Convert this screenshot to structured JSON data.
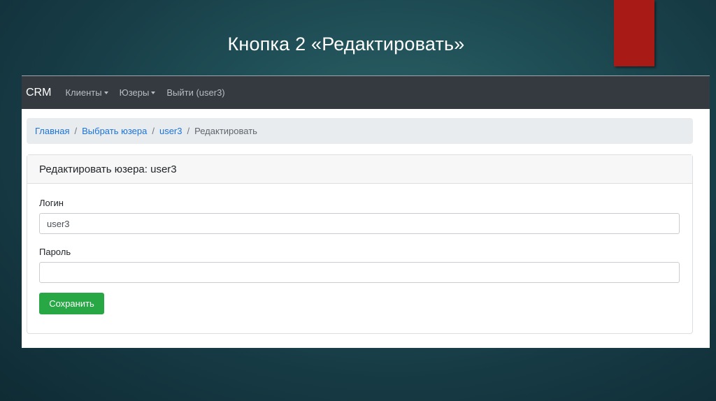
{
  "slide": {
    "title": "Кнопка 2 «Редактировать»"
  },
  "navbar": {
    "brand": "CRM",
    "items": [
      {
        "label": "Клиенты",
        "has_dropdown": true
      },
      {
        "label": "Юзеры",
        "has_dropdown": true
      },
      {
        "label": "Выйти (user3)",
        "has_dropdown": false
      }
    ]
  },
  "breadcrumb": {
    "items": [
      {
        "label": "Главная",
        "link": true
      },
      {
        "label": "Выбрать юзера",
        "link": true
      },
      {
        "label": "user3",
        "link": true
      },
      {
        "label": "Редактировать",
        "link": false
      }
    ],
    "separator": "/"
  },
  "card": {
    "header": "Редактировать юзера: user3",
    "login_label": "Логин",
    "login_value": "user3",
    "password_label": "Пароль",
    "password_value": "",
    "save_label": "Сохранить"
  },
  "colors": {
    "navbar_bg": "#343a40",
    "link": "#1a73d9",
    "success": "#28a745",
    "accent_red": "#a81a16"
  }
}
